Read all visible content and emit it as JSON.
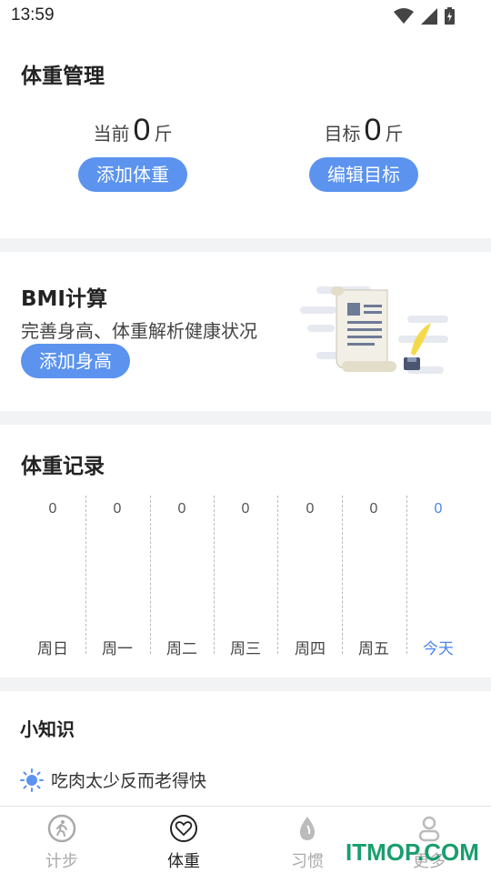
{
  "status_bar": {
    "time": "13:59"
  },
  "weight_card": {
    "title": "体重管理",
    "current_label": "当前",
    "current_value": "0",
    "current_unit": "斤",
    "target_label": "目标",
    "target_value": "0",
    "target_unit": "斤",
    "add_weight_button": "添加体重",
    "edit_target_button": "编辑目标"
  },
  "bmi_card": {
    "title": "BMI计算",
    "subtitle": "完善身高、体重解析健康状况",
    "add_height_button": "添加身高"
  },
  "record_card": {
    "title": "体重记录",
    "days": [
      {
        "label": "周日",
        "value": "0"
      },
      {
        "label": "周一",
        "value": "0"
      },
      {
        "label": "周二",
        "value": "0"
      },
      {
        "label": "周三",
        "value": "0"
      },
      {
        "label": "周四",
        "value": "0"
      },
      {
        "label": "周五",
        "value": "0"
      },
      {
        "label": "今天",
        "value": "0"
      }
    ],
    "accent_color": "#4a86e8"
  },
  "tips_card": {
    "title": "小知识",
    "tip": "吃肉太少反而老得快",
    "tip_icon": "lightbulb-icon"
  },
  "tabbar": {
    "tabs": [
      {
        "label": "计步",
        "icon": "walking-icon"
      },
      {
        "label": "体重",
        "icon": "heart-icon"
      },
      {
        "label": "习惯",
        "icon": "drop-icon"
      },
      {
        "label": "更多",
        "icon": "person-icon"
      }
    ]
  },
  "watermark": "ITMOP.COM",
  "colors": {
    "primary_button": "#5b93ee",
    "background": "#f2f3f5"
  }
}
